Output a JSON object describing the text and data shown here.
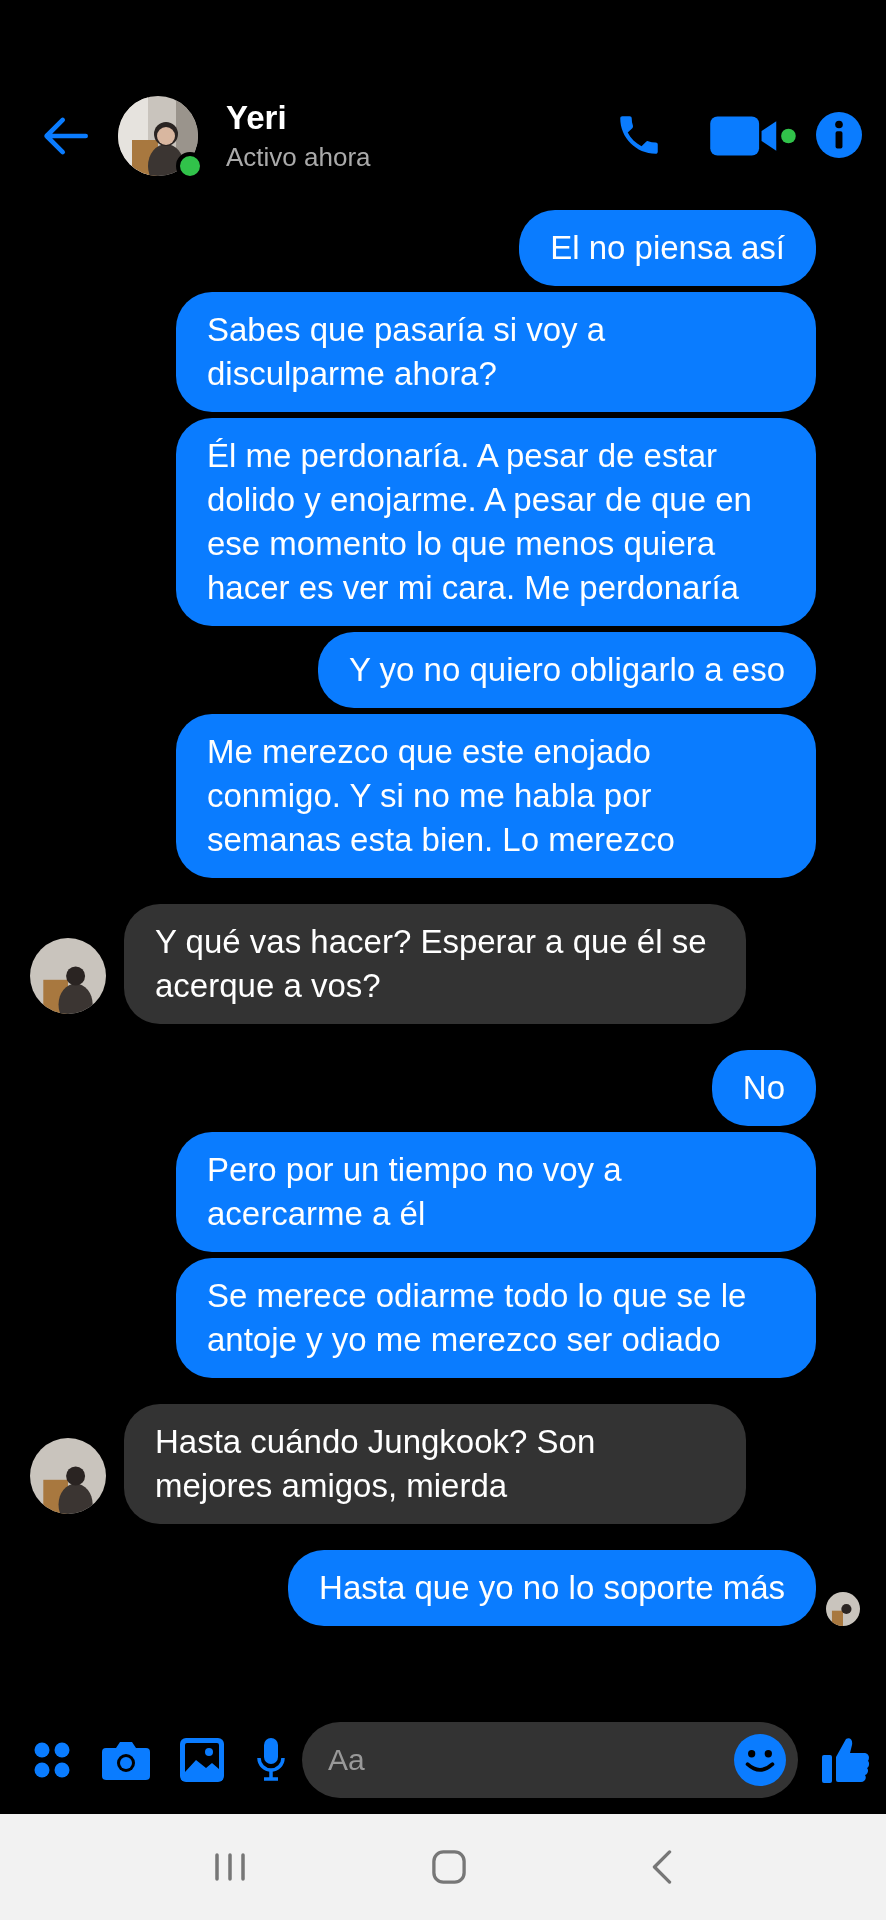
{
  "header": {
    "name": "Yeri",
    "status": "Activo ahora",
    "online": true
  },
  "messages": [
    {
      "kind": "sent",
      "text": "El no piensa así",
      "seen": false
    },
    {
      "kind": "sent",
      "text": "Sabes que pasaría si voy a disculparme ahora?",
      "seen": false
    },
    {
      "kind": "sent",
      "text": "Él me perdonaría. A pesar de estar dolido y enojarme. A pesar de que en ese momento lo que menos quiera hacer es ver mi cara. Me perdonaría",
      "seen": false
    },
    {
      "kind": "sent",
      "text": "Y yo no quiero obligarlo a eso",
      "seen": false
    },
    {
      "kind": "sent",
      "text": "Me merezco que este enojado conmigo. Y si no me habla por semanas esta bien. Lo merezco",
      "seen": false
    },
    {
      "kind": "received",
      "text": "Y qué vas hacer? Esperar a que él se acerque a vos?",
      "seen": false
    },
    {
      "kind": "sent",
      "text": "No",
      "seen": false
    },
    {
      "kind": "sent",
      "text": "Pero por un tiempo no voy a acercarme a él",
      "seen": false
    },
    {
      "kind": "sent",
      "text": "Se merece odiarme todo lo que se le antoje y yo me merezco ser odiado",
      "seen": false
    },
    {
      "kind": "received",
      "text": "Hasta cuándo Jungkook? Son mejores amigos, mierda",
      "seen": false
    },
    {
      "kind": "sent",
      "text": "Hasta que yo no lo soporte más",
      "seen": true
    }
  ],
  "composer": {
    "placeholder": "Aa"
  }
}
